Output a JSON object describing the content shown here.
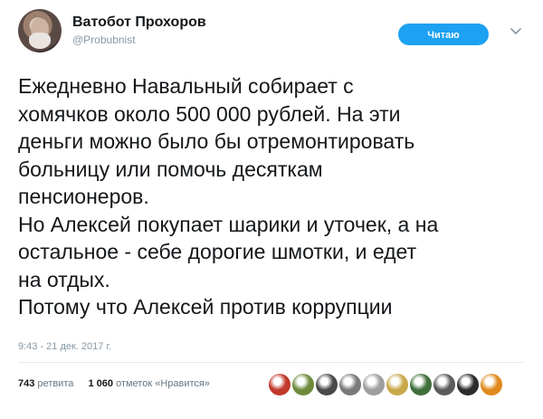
{
  "author": {
    "name": "Ватобот Прохоров",
    "handle": "@Probubnist"
  },
  "follow_button": {
    "label": "Читаю"
  },
  "tweet": {
    "lines": [
      "Ежедневно Навальный собирает с",
      "хомячков около 500 000 рублей. На эти",
      "деньги можно было бы отремонтировать",
      "больницу или помочь десяткам",
      "пенсионеров.",
      "Но Алексей покупает шарики и уточек, а на",
      "остальное - себе дорогие шмотки, и едет",
      "на отдых.",
      "Потому что Алексей против коррупции"
    ],
    "timestamp": "9:43 - 21 дек. 2017 г."
  },
  "stats": {
    "retweets_count": "743",
    "retweets_label": "ретвита",
    "likes_count": "1 060",
    "likes_label": "отметок «Нравится»"
  },
  "likers": [
    {
      "icon": "avatar-red-figure",
      "color": "#c0392b"
    },
    {
      "icon": "avatar-bird",
      "color": "#6e8b3d"
    },
    {
      "icon": "avatar-dark",
      "color": "#4a4a4a"
    },
    {
      "icon": "avatar-car",
      "color": "#7a7a7a"
    },
    {
      "icon": "avatar-person",
      "color": "#9e9e9e"
    },
    {
      "icon": "avatar-coins",
      "color": "#c9a84a"
    },
    {
      "icon": "avatar-tree",
      "color": "#3f6f3a"
    },
    {
      "icon": "avatar-cat",
      "color": "#5b5b5b"
    },
    {
      "icon": "avatar-bear",
      "color": "#2c2c2c"
    },
    {
      "icon": "avatar-orange",
      "color": "#e08a1e"
    }
  ],
  "colors": {
    "accent": "#1da1f2",
    "text": "#14171a",
    "muted": "#8899a6"
  }
}
